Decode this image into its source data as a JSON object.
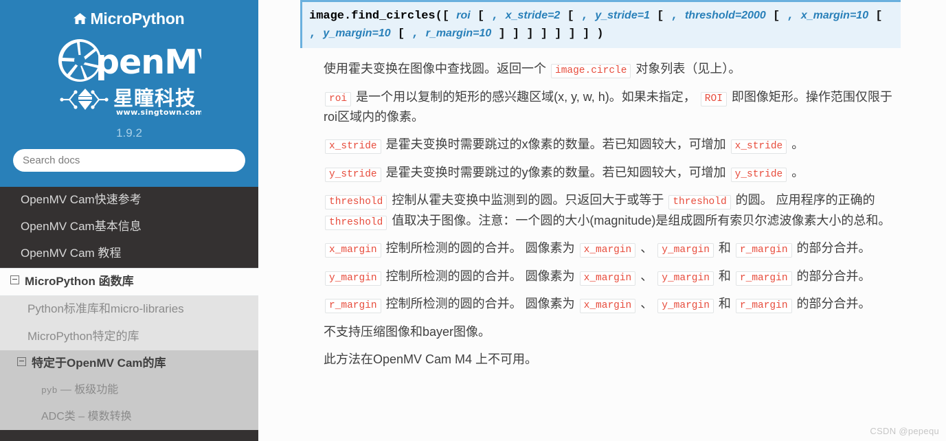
{
  "sidebar": {
    "brand": "MicroPython",
    "home_icon": "home-icon",
    "logo_alt": "OpenMV 星瞳科技 www.singtown.com",
    "logo_text_top": "OpenMV",
    "logo_text_bottom": "星瞳科技",
    "logo_url_text": "www.singtown.com",
    "version": "1.9.2",
    "search_placeholder": "Search docs",
    "search_value": "",
    "nav": [
      {
        "label": "OpenMV Cam快速参考",
        "level": 1,
        "state": "dark",
        "expandable": false
      },
      {
        "label": "OpenMV Cam基本信息",
        "level": 1,
        "state": "dark",
        "expandable": false
      },
      {
        "label": "OpenMV Cam 教程",
        "level": 1,
        "state": "dark",
        "expandable": false
      },
      {
        "label": "MicroPython 函数库",
        "level": 1,
        "state": "current",
        "expandable": true
      },
      {
        "label": "Python标准库和micro-libraries",
        "level": 2,
        "state": "normal",
        "expandable": false
      },
      {
        "label": "MicroPython特定的库",
        "level": 2,
        "state": "normal",
        "expandable": false
      },
      {
        "label": "特定于OpenMV Cam的库",
        "level": 2,
        "state": "current",
        "expandable": true
      },
      {
        "label": "pyb — 板级功能",
        "level": 3,
        "state": "normal",
        "expandable": false,
        "mono_prefix": "pyb",
        "rest": " — 板级功能"
      },
      {
        "label": "ADC类 – 模数转换",
        "level": 3,
        "state": "normal",
        "expandable": false
      }
    ]
  },
  "signature": {
    "name": "image.find_circles",
    "open_paren": "(",
    "tokens": [
      {
        "t": "bracket",
        "v": "["
      },
      {
        "t": "param",
        "v": "roi"
      },
      {
        "t": "bracket",
        "v": "["
      },
      {
        "t": "punct",
        "v": ","
      },
      {
        "t": "param",
        "v": "x_stride=2"
      },
      {
        "t": "bracket",
        "v": "["
      },
      {
        "t": "punct",
        "v": ","
      },
      {
        "t": "param",
        "v": "y_stride=1"
      },
      {
        "t": "bracket",
        "v": "["
      },
      {
        "t": "punct",
        "v": ","
      },
      {
        "t": "param",
        "v": "threshold=2000"
      },
      {
        "t": "bracket",
        "v": "["
      },
      {
        "t": "punct",
        "v": ","
      },
      {
        "t": "param",
        "v": "x_margin=10"
      },
      {
        "t": "bracket",
        "v": "["
      },
      {
        "t": "punct",
        "v": ","
      },
      {
        "t": "param",
        "v": "y_margin=10"
      },
      {
        "t": "bracket",
        "v": "["
      },
      {
        "t": "punct",
        "v": ","
      },
      {
        "t": "param",
        "v": "r_margin=10"
      },
      {
        "t": "bracket",
        "v": "]"
      },
      {
        "t": "bracket",
        "v": "]"
      },
      {
        "t": "bracket",
        "v": "]"
      },
      {
        "t": "bracket",
        "v": "]"
      },
      {
        "t": "bracket",
        "v": "]"
      },
      {
        "t": "bracket",
        "v": "]"
      },
      {
        "t": "bracket",
        "v": "]"
      }
    ],
    "close_paren": ")",
    "full_text": "image.find_circles([roi[, x_stride=2[, y_stride=1[, threshold=2000[, x_margin=10[, y_margin=10[, r_margin=10]]]]]]])"
  },
  "paragraphs": [
    {
      "id": "intro",
      "parts": [
        {
          "t": "text",
          "v": "使用霍夫变换在图像中查找圆。返回一个 "
        },
        {
          "t": "code_plain",
          "v": "image.circle"
        },
        {
          "t": "text",
          "v": " 对象列表（见上）。"
        }
      ]
    },
    {
      "id": "roi",
      "parts": [
        {
          "t": "code",
          "v": "roi"
        },
        {
          "t": "text",
          "v": " 是一个用以复制的矩形的感兴趣区域(x, y, w, h)。如果未指定， "
        },
        {
          "t": "code_plain",
          "v": "ROI"
        },
        {
          "t": "text",
          "v": " 即图像矩形。操作范围仅限于roi区域内的像素。"
        }
      ]
    },
    {
      "id": "x_stride",
      "parts": [
        {
          "t": "code",
          "v": "x_stride"
        },
        {
          "t": "text",
          "v": " 是霍夫变换时需要跳过的x像素的数量。若已知圆较大，可增加 "
        },
        {
          "t": "code_plain",
          "v": "x_stride"
        },
        {
          "t": "text",
          "v": " 。"
        }
      ]
    },
    {
      "id": "y_stride",
      "parts": [
        {
          "t": "code",
          "v": "y_stride"
        },
        {
          "t": "text",
          "v": " 是霍夫变换时需要跳过的y像素的数量。若已知圆较大，可增加 "
        },
        {
          "t": "code_plain",
          "v": "y_stride"
        },
        {
          "t": "text",
          "v": " 。"
        }
      ]
    },
    {
      "id": "threshold",
      "parts": [
        {
          "t": "code",
          "v": "threshold"
        },
        {
          "t": "text",
          "v": " 控制从霍夫变换中监测到的圆。只返回大于或等于 "
        },
        {
          "t": "code_plain",
          "v": "threshold"
        },
        {
          "t": "text",
          "v": " 的圆。 应用程序的正确的 "
        },
        {
          "t": "code_plain",
          "v": "threshold"
        },
        {
          "t": "text",
          "v": " 值取决于图像。注意：一个圆的大小(magnitude)是组成圆所有索贝尔滤波像素大小的总和。"
        }
      ]
    },
    {
      "id": "x_margin",
      "parts": [
        {
          "t": "code",
          "v": "x_margin"
        },
        {
          "t": "text",
          "v": " 控制所检测的圆的合并。 圆像素为 "
        },
        {
          "t": "code_plain",
          "v": "x_margin"
        },
        {
          "t": "text",
          "v": " 、 "
        },
        {
          "t": "code",
          "v": "y_margin"
        },
        {
          "t": "text",
          "v": " 和 "
        },
        {
          "t": "code_plain",
          "v": "r_margin"
        },
        {
          "t": "text",
          "v": " 的部分合并。"
        }
      ]
    },
    {
      "id": "y_margin",
      "parts": [
        {
          "t": "code",
          "v": "y_margin"
        },
        {
          "t": "text",
          "v": " 控制所检测的圆的合并。 圆像素为 "
        },
        {
          "t": "code_plain",
          "v": "x_margin"
        },
        {
          "t": "text",
          "v": " 、 "
        },
        {
          "t": "code",
          "v": "y_margin"
        },
        {
          "t": "text",
          "v": " 和 "
        },
        {
          "t": "code_plain",
          "v": "r_margin"
        },
        {
          "t": "text",
          "v": " 的部分合并。"
        }
      ]
    },
    {
      "id": "r_margin",
      "parts": [
        {
          "t": "code",
          "v": "r_margin"
        },
        {
          "t": "text",
          "v": " 控制所检测的圆的合并。 圆像素为 "
        },
        {
          "t": "code_plain",
          "v": "x_margin"
        },
        {
          "t": "text",
          "v": " 、 "
        },
        {
          "t": "code",
          "v": "y_margin"
        },
        {
          "t": "text",
          "v": " 和 "
        },
        {
          "t": "code_plain",
          "v": "r_margin"
        },
        {
          "t": "text",
          "v": " 的部分合并。"
        }
      ]
    },
    {
      "id": "no-compressed",
      "parts": [
        {
          "t": "text",
          "v": "不支持压缩图像和bayer图像。"
        }
      ]
    },
    {
      "id": "not-available-m4",
      "parts": [
        {
          "t": "text",
          "v": "此方法在OpenMV Cam M4 上不可用。"
        }
      ]
    }
  ],
  "watermark": "CSDN @pepequ",
  "colors": {
    "sidebar_top": "#2980b9",
    "sidebar_dark": "#343131",
    "sidebar_lvl2": "#e3e3e3",
    "sidebar_lvl2_current": "#c9c9c9",
    "code_block_bg": "#e7f2fa",
    "code_block_border": "#6ab0de",
    "inline_code_text": "#e74c3c",
    "body_text": "#404040",
    "param_blue": "#2980b9"
  }
}
